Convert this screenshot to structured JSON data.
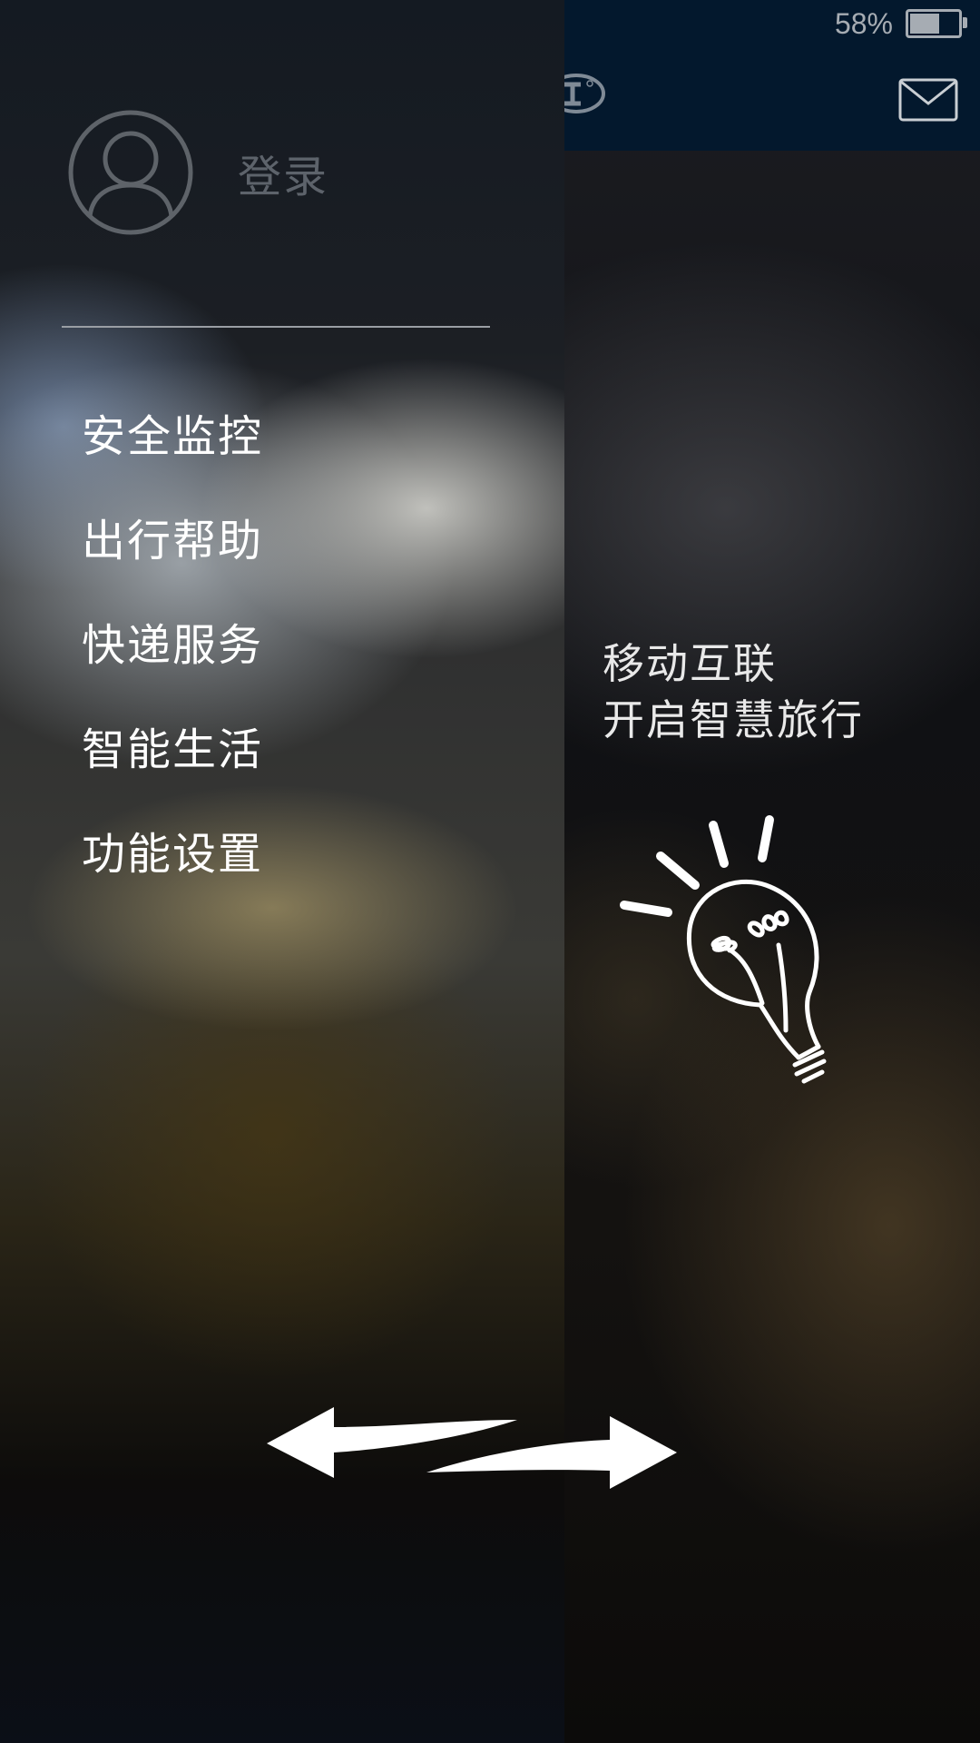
{
  "status_bar": {
    "battery_text": "58%",
    "battery_level": 0.58
  },
  "app": {
    "tagline_line1": "移动互联",
    "tagline_line2": "开启智慧旅行"
  },
  "drawer": {
    "login_label": "登录",
    "menu": [
      {
        "label": "安全监控"
      },
      {
        "label": "出行帮助"
      },
      {
        "label": "快递服务"
      },
      {
        "label": "智能生活"
      },
      {
        "label": "功能设置"
      }
    ]
  },
  "icons": {
    "mail": "mail-icon",
    "avatar": "user-avatar-icon",
    "bulb": "lightbulb-icon",
    "arrows": "swipe-arrows-icon",
    "logo": "app-logo-icon"
  },
  "colors": {
    "topbar": "#03182d",
    "drawer_text": "#ffffff",
    "login_text": "#5d636b"
  }
}
